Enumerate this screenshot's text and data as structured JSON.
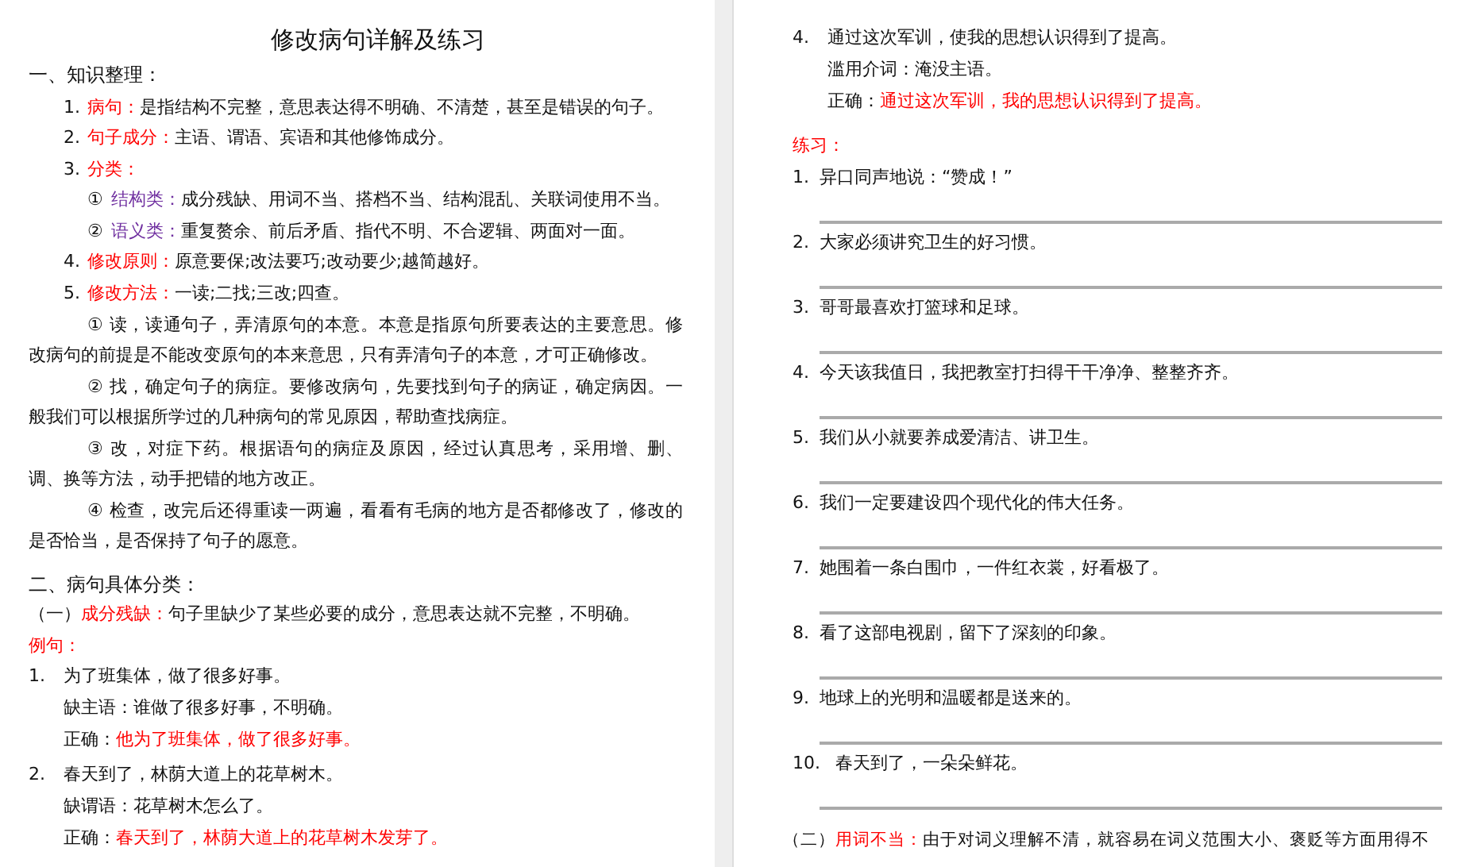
{
  "left_page": {
    "title": "修改病句详解及练习",
    "section_1": {
      "heading": "一、知识整理：",
      "items": [
        {
          "kind": "term",
          "number": "1.",
          "label": "病句：",
          "text": "是指结构不完整，意思表达得不明确、不清楚，甚至是错误的句子。"
        },
        {
          "kind": "term",
          "number": "2.",
          "label": "句子成分：",
          "text": "主语、谓语、宾语和其他修饰成分。"
        },
        {
          "kind": "term",
          "number": "3.",
          "label": "分类："
        },
        {
          "kind": "sub",
          "number": "①",
          "label": "结构类：",
          "text": "成分残缺、用词不当、搭档不当、结构混乱、关联词使用不当。"
        },
        {
          "kind": "sub",
          "number": "②",
          "label": "语义类：",
          "text": "重复赘余、前后矛盾、指代不明、不合逻辑、两面对一面。"
        },
        {
          "kind": "term",
          "number": "4.",
          "label": "修改原则：",
          "text": "原意要保;改法要巧;改动要少;越简越好。"
        },
        {
          "kind": "term",
          "number": "5.",
          "label": "修改方法：",
          "text": "一读;二找;三改;四查。"
        },
        {
          "kind": "step",
          "number": "①",
          "text": "读，读通句子，弄清原句的本意。本意是指原句所要表达的主要意思。修改病句的前提是不能改变原句的本来意思，只有弄清句子的本意，才可正确修改。"
        },
        {
          "kind": "step",
          "number": "②",
          "text": "找，确定句子的病症。要修改病句，先要找到句子的病证，确定病因。一般我们可以根据所学过的几种病句的常见原因，帮助查找病症。"
        },
        {
          "kind": "step",
          "number": "③",
          "text": "改，对症下药。根据语句的病症及原因，经过认真思考，采用增、删、调、换等方法，动手把错的地方改正。"
        },
        {
          "kind": "step",
          "number": "④",
          "text": "检查，改完后还得重读一两遍，看看有毛病的地方是否都修改了，修改的是否恰当，是否保持了句子的愿意。"
        }
      ]
    },
    "section_2": {
      "heading": "二、病句具体分类：",
      "category": {
        "number": "（一）",
        "label": "成分残缺：",
        "text": "句子里缺少了某些必要的成分，意思表达就不完整，不明确。"
      },
      "examples_label": "例句：",
      "examples": [
        {
          "number": "1.",
          "sentence": "为了班集体，做了很多好事。",
          "note": "缺主语：谁做了很多好事，不明确。",
          "correct_label": "正确：",
          "correct": "他为了班集体，做了很多好事。"
        },
        {
          "number": "2.",
          "sentence": "春天到了，林荫大道上的花草树木。",
          "note": "缺谓语：花草树木怎么了。",
          "correct_label": "正确：",
          "correct": "春天到了，林荫大道上的花草树木发芽了。"
        }
      ]
    }
  },
  "right_page": {
    "examples": [
      {
        "number": "4.",
        "sentence": "通过这次军训，使我的思想认识得到了提高。",
        "note": "滥用介词：淹没主语。",
        "correct_label": "正确：",
        "correct": "通过这次军训，我的思想认识得到了提高。"
      }
    ],
    "practice_label": "练习：",
    "exercises": [
      {
        "number": "1.",
        "sentence": "异口同声地说：“赞成！”"
      },
      {
        "number": "2.",
        "sentence": "大家必须讲究卫生的好习惯。"
      },
      {
        "number": "3.",
        "sentence": "哥哥最喜欢打篮球和足球。"
      },
      {
        "number": "4.",
        "sentence": "今天该我值日，我把教室打扫得干干净净、整整齐齐。"
      },
      {
        "number": "5.",
        "sentence": "我们从小就要养成爱清洁、讲卫生。"
      },
      {
        "number": "6.",
        "sentence": "我们一定要建设四个现代化的伟大任务。"
      },
      {
        "number": "7.",
        "sentence": "她围着一条白围巾，一件红衣裳，好看极了。"
      },
      {
        "number": "8.",
        "sentence": "看了这部电视剧，留下了深刻的印象。"
      },
      {
        "number": "9.",
        "sentence": "地球上的光明和温暖都是送来的。"
      },
      {
        "number": "10.",
        "sentence": "春天到了，一朵朵鲜花。"
      }
    ],
    "category": {
      "number": "（二）",
      "label": "用词不当：",
      "text": "由于对词义理解不清，就容易在词义范围大小、褒贬等方面用得不"
    }
  }
}
